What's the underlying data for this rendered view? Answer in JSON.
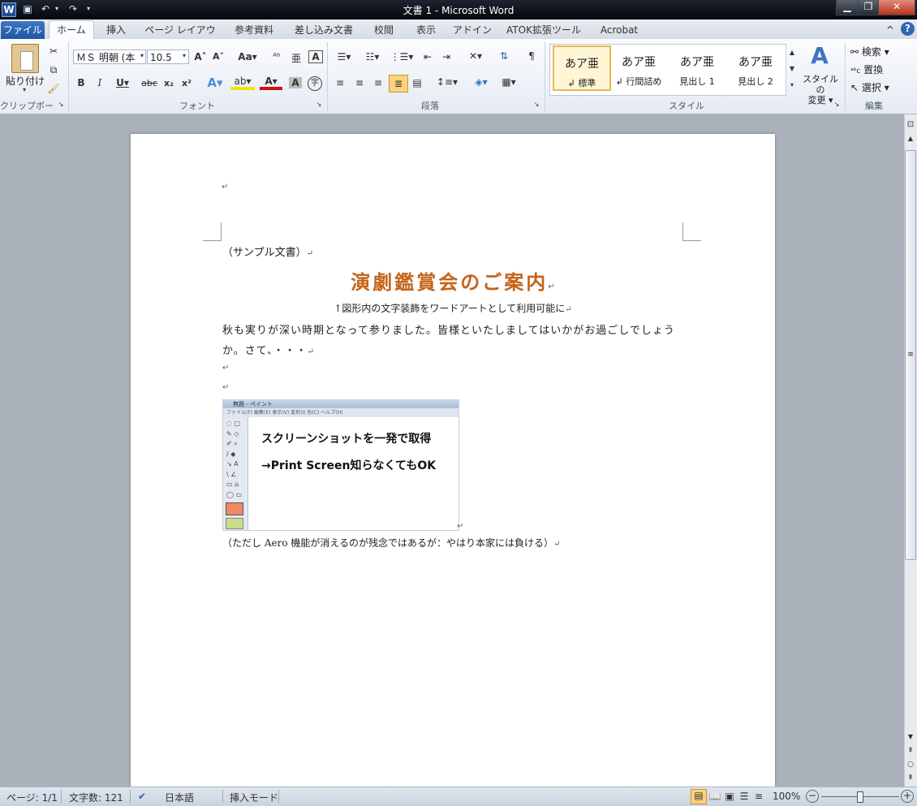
{
  "titlebar": {
    "title": "文書 1 - Microsoft Word",
    "app_icon": "W"
  },
  "tabs": [
    "ファイル",
    "ホーム",
    "挿入",
    "ページ レイアウト",
    "参考資料",
    "差し込み文書",
    "校閲",
    "表示",
    "アドイン",
    "ATOK拡張ツール",
    "Acrobat"
  ],
  "ribbon": {
    "clipboard": {
      "paste_label": "貼り付け",
      "group": "クリップボード"
    },
    "font": {
      "name": "ＭＳ 明朝 (本",
      "size": "10.5",
      "group": "フォント",
      "aa_label": "Aa"
    },
    "paragraph": {
      "group": "段落"
    },
    "styles": {
      "items": [
        {
          "sample": "あア亜",
          "name": "↲ 標準"
        },
        {
          "sample": "あア亜",
          "name": "↲ 行間詰め"
        },
        {
          "sample": "あア亜",
          "name": "見出し 1"
        },
        {
          "sample": "あア亜",
          "name": "見出し 2"
        }
      ],
      "change_label_1": "スタイルの",
      "change_label_2": "変更 ▾",
      "group": "スタイル"
    },
    "editing": {
      "find": "検索",
      "replace": "置換",
      "select": "選択",
      "group": "編集"
    }
  },
  "document": {
    "sample_note": "（サンプル文書）",
    "title": "演劇鑑賞会のご案内",
    "wordart_note": "↑図形内の文字装飾をワードアートとして利用可能に",
    "body_line1": "秋も実りが深い時期となって参りました。皆様といたしましてはいかがお過ごしでしょう",
    "body_line2": "か。さて、・・・",
    "screenshot": {
      "window_title": "無題 - ペイント",
      "menu": "ファイル(F)   編集(E)   表示(V)   変形(I)   色(C)   ヘルプ(H)",
      "line1": "スクリーンショットを一発で取得",
      "line2": "→Print Screen知らなくてもOK"
    },
    "footer_note": "（ただし Aero 機能が消えるのが残念ではあるが：やはり本家には負ける）",
    "para_mark": "↵"
  },
  "statusbar": {
    "page": "ページ: 1/1",
    "words": "文字数: 121",
    "language": "日本語",
    "mode": "挿入モード",
    "zoom": "100%"
  },
  "colors": {
    "title_orange": "#c4651b",
    "file_tab": "#2a63b1"
  }
}
